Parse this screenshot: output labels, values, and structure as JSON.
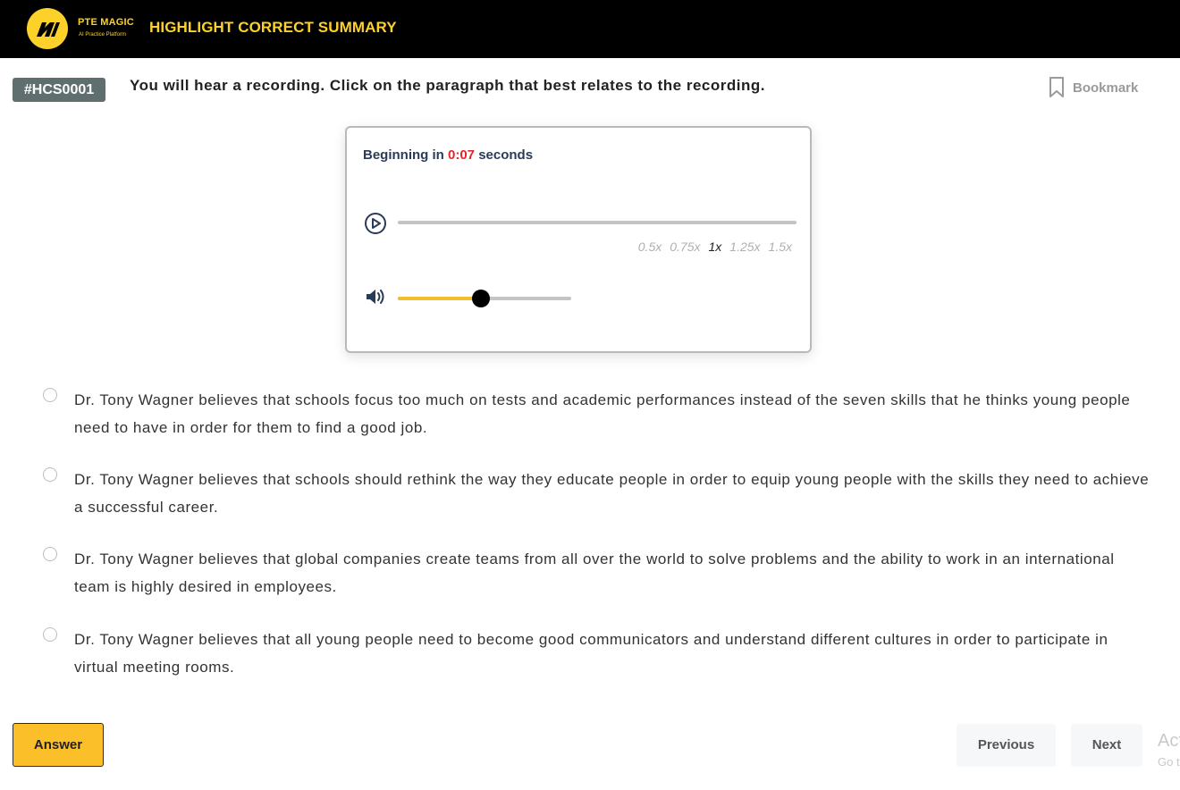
{
  "header": {
    "brand_name": "PTE MAGIC",
    "brand_tagline": "AI Practice Platform",
    "title": "HIGHLIGHT CORRECT SUMMARY"
  },
  "question": {
    "id_badge": "#HCS0001",
    "instruction": "You will hear a recording. Click on the paragraph that best relates to the recording.",
    "bookmark_label": "Bookmark"
  },
  "player": {
    "countdown_prefix": "Beginning in",
    "countdown_time": "0:07",
    "countdown_suffix": "seconds",
    "playback_progress": 0,
    "speeds": [
      "0.5x",
      "0.75x",
      "1x",
      "1.25x",
      "1.5x"
    ],
    "selected_speed": "1x",
    "volume_level": 0.48
  },
  "options": [
    {
      "text": "Dr. Tony Wagner believes that schools focus too much on tests and academic performances instead of the seven skills that he thinks young people need to have in order for them to find a good job."
    },
    {
      "text": "Dr. Tony Wagner believes that schools should rethink the way they educate people in order to equip young people with the skills they need to achieve a successful career."
    },
    {
      "text": "Dr. Tony Wagner believes that global companies create teams from all over the world to solve problems and the ability to work in an international team is highly desired in employees."
    },
    {
      "text": "Dr. Tony Wagner believes that all young people need to become good communicators and understand different cultures in order to participate in virtual meeting rooms."
    }
  ],
  "footer": {
    "answer_label": "Answer",
    "previous_label": "Previous",
    "next_label": "Next"
  },
  "watermark": {
    "line1": "Act",
    "line2": "Go t"
  },
  "colors": {
    "brand_yellow": "#fcd12a",
    "countdown_red": "#e8232a",
    "volume_fill": "#f2be2b",
    "badge_gray": "#5f6f70"
  }
}
